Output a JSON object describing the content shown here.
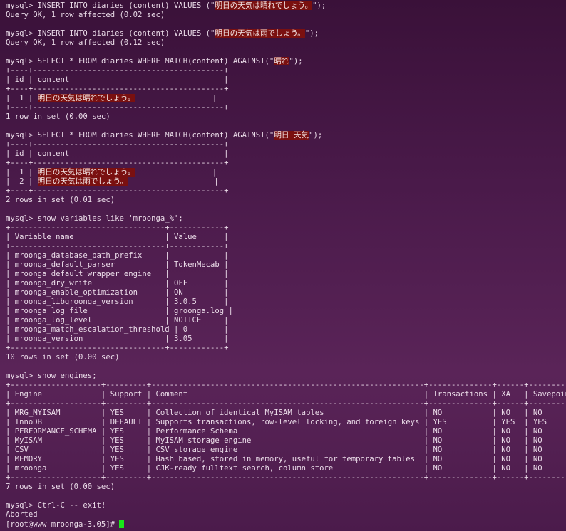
{
  "terminal": {
    "prompt": "mysql> ",
    "lines": [
      {
        "t": "cmd",
        "pre": "INSERT INTO diaries (content) VALUES (\"",
        "hl": "明日の天気は晴れでしょう。",
        "post": "\");"
      },
      {
        "t": "text",
        "text": "Query OK, 1 row affected (0.02 sec)"
      },
      {
        "t": "blank"
      },
      {
        "t": "cmd",
        "pre": "INSERT INTO diaries (content) VALUES (\"",
        "hl": "明日の天気は雨でしょう。",
        "post": "\");"
      },
      {
        "t": "text",
        "text": "Query OK, 1 row affected (0.12 sec)"
      },
      {
        "t": "blank"
      },
      {
        "t": "cmd",
        "pre": "SELECT * FROM diaries WHERE MATCH(content) AGAINST(\"",
        "hl": "晴れ",
        "post": "\");"
      },
      {
        "t": "border",
        "text": "+----+------------------------------------------+"
      },
      {
        "t": "text",
        "text": "| id | content                                  |"
      },
      {
        "t": "border",
        "text": "+----+------------------------------------------+"
      },
      {
        "t": "row",
        "pre": "|  1 | ",
        "hl": "明日の天気は晴れでしょう。",
        "post": "                 |"
      },
      {
        "t": "border",
        "text": "+----+------------------------------------------+"
      },
      {
        "t": "text",
        "text": "1 row in set (0.00 sec)"
      },
      {
        "t": "blank"
      },
      {
        "t": "cmd",
        "pre": "SELECT * FROM diaries WHERE MATCH(content) AGAINST(\"",
        "hl": "明日",
        "mid": " ",
        "hl2": "天気",
        "post": "\");"
      },
      {
        "t": "border",
        "text": "+----+------------------------------------------+"
      },
      {
        "t": "text",
        "text": "| id | content                                  |"
      },
      {
        "t": "border",
        "text": "+----+------------------------------------------+"
      },
      {
        "t": "row",
        "pre": "|  1 | ",
        "hl": "明日の天気は晴れでしょう。",
        "post": "                 |"
      },
      {
        "t": "row",
        "pre": "|  2 | ",
        "hl": "明日の天気は雨でしょう。",
        "post": "                   |"
      },
      {
        "t": "border",
        "text": "+----+------------------------------------------+"
      },
      {
        "t": "text",
        "text": "2 rows in set (0.01 sec)"
      },
      {
        "t": "blank"
      },
      {
        "t": "cmd",
        "pre": "show variables like 'mroonga_%';"
      },
      {
        "t": "border",
        "text": "+----------------------------------+------------+"
      },
      {
        "t": "text",
        "text": "| Variable_name                    | Value      |"
      },
      {
        "t": "border",
        "text": "+----------------------------------+------------+"
      },
      {
        "t": "text",
        "text": "| mroonga_database_path_prefix     |            |"
      },
      {
        "t": "text",
        "text": "| mroonga_default_parser           | TokenMecab |"
      },
      {
        "t": "text",
        "text": "| mroonga_default_wrapper_engine   |            |"
      },
      {
        "t": "text",
        "text": "| mroonga_dry_write                | OFF        |"
      },
      {
        "t": "text",
        "text": "| mroonga_enable_optimization      | ON         |"
      },
      {
        "t": "text",
        "text": "| mroonga_libgroonga_version       | 3.0.5      |"
      },
      {
        "t": "text",
        "text": "| mroonga_log_file                 | groonga.log |"
      },
      {
        "t": "text",
        "text": "| mroonga_log_level                | NOTICE     |"
      },
      {
        "t": "text",
        "text": "| mroonga_match_escalation_threshold | 0        |"
      },
      {
        "t": "text",
        "text": "| mroonga_version                  | 3.05       |"
      },
      {
        "t": "border",
        "text": "+----------------------------------+------------+"
      },
      {
        "t": "text",
        "text": "10 rows in set (0.00 sec)"
      },
      {
        "t": "blank"
      },
      {
        "t": "cmd",
        "pre": "show engines;"
      },
      {
        "t": "border",
        "text": "+--------------------+---------+------------------------------------------------------------+--------------+------+------------+"
      },
      {
        "t": "text",
        "text": "| Engine             | Support | Comment                                                    | Transactions | XA   | Savepoints |"
      },
      {
        "t": "border",
        "text": "+--------------------+---------+------------------------------------------------------------+--------------+------+------------+"
      },
      {
        "t": "text",
        "text": "| MRG_MYISAM         | YES     | Collection of identical MyISAM tables                      | NO           | NO   | NO         |"
      },
      {
        "t": "text",
        "text": "| InnoDB             | DEFAULT | Supports transactions, row-level locking, and foreign keys | YES          | YES  | YES        |"
      },
      {
        "t": "text",
        "text": "| PERFORMANCE_SCHEMA | YES     | Performance Schema                                         | NO           | NO   | NO         |"
      },
      {
        "t": "text",
        "text": "| MyISAM             | YES     | MyISAM storage engine                                      | NO           | NO   | NO         |"
      },
      {
        "t": "text",
        "text": "| CSV                | YES     | CSV storage engine                                         | NO           | NO   | NO         |"
      },
      {
        "t": "text",
        "text": "| MEMORY             | YES     | Hash based, stored in memory, useful for temporary tables  | NO           | NO   | NO         |"
      },
      {
        "t": "text",
        "text": "| mroonga            | YES     | CJK-ready fulltext search, column store                    | NO           | NO   | NO         |"
      },
      {
        "t": "border",
        "text": "+--------------------+---------+------------------------------------------------------------+--------------+------+------------+"
      },
      {
        "t": "text",
        "text": "7 rows in set (0.00 sec)"
      },
      {
        "t": "blank"
      },
      {
        "t": "cmd",
        "pre": "Ctrl-C -- exit!"
      },
      {
        "t": "text",
        "text": "Aborted"
      }
    ],
    "shell_prompt": "[root@www mroonga-3.05]# "
  },
  "colors": {
    "highlight_bg": "#7a1010",
    "cursor": "#19e619",
    "text": "#eadbe8",
    "background": "#4a1a4a"
  }
}
